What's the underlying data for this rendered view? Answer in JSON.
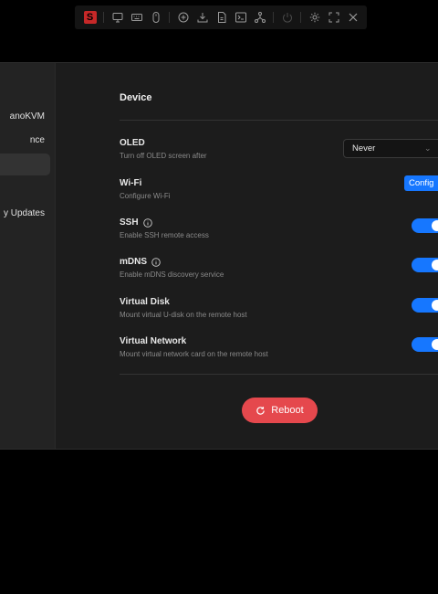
{
  "toolbar": {
    "logo_letter": "S",
    "icons": [
      "screen-icon",
      "keyboard-icon",
      "mouse-icon",
      "add-circle-icon",
      "download-icon",
      "file-icon",
      "terminal-icon",
      "network-icon",
      "power-icon",
      "settings-icon",
      "fullscreen-icon",
      "close-icon"
    ]
  },
  "sidebar": {
    "items": [
      {
        "label": "anoKVM",
        "active": false
      },
      {
        "label": "nce",
        "active": false
      },
      {
        "label": "",
        "active": true
      },
      {
        "label": "y Updates",
        "active": false
      }
    ]
  },
  "device": {
    "title": "Device",
    "oled": {
      "label": "OLED",
      "desc": "Turn off OLED screen after",
      "value": "Never"
    },
    "wifi": {
      "label": "Wi-Fi",
      "desc": "Configure Wi-Fi",
      "button": "Config"
    },
    "ssh": {
      "label": "SSH",
      "desc": "Enable SSH remote access",
      "enabled": true
    },
    "mdns": {
      "label": "mDNS",
      "desc": "Enable mDNS discovery service",
      "enabled": true
    },
    "virtual_disk": {
      "label": "Virtual Disk",
      "desc": "Mount virtual U-disk on the remote host",
      "enabled": true
    },
    "virtual_network": {
      "label": "Virtual Network",
      "desc": "Mount virtual network card on the remote host",
      "enabled": true
    },
    "reboot_label": "Reboot"
  },
  "colors": {
    "accent": "#1677ff",
    "danger": "#e5484d",
    "logo": "#c62828"
  }
}
